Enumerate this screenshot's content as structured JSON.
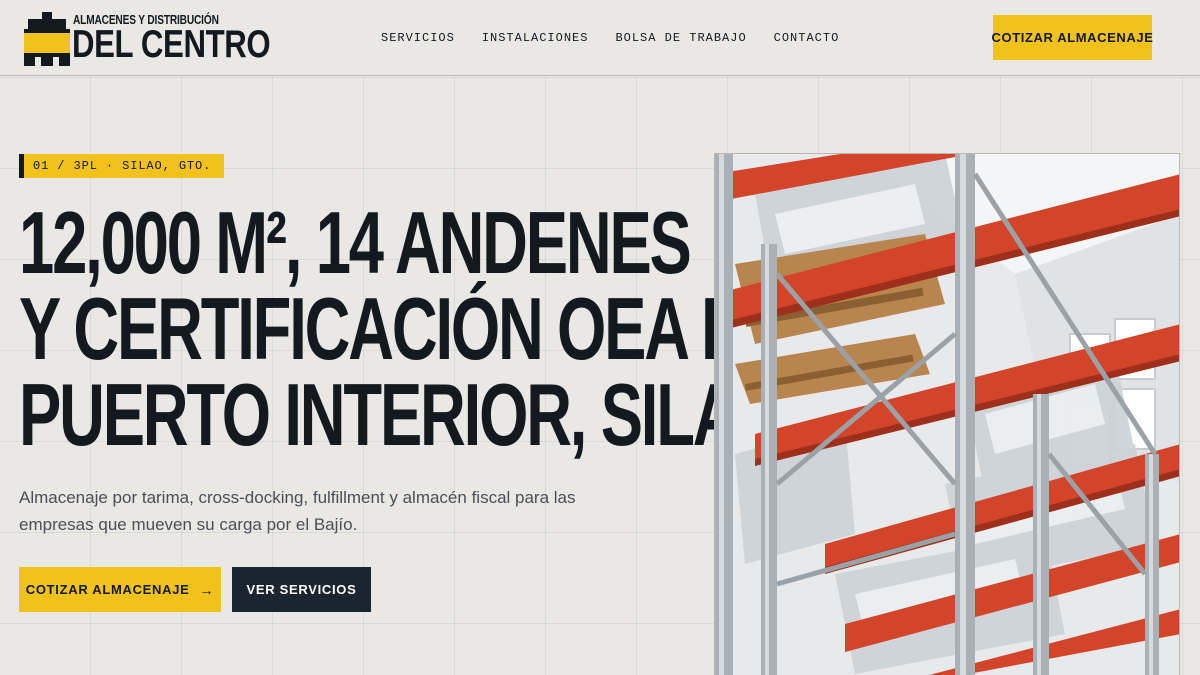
{
  "brand": {
    "name_top": "ALMACENES Y DISTRIBUCIÓN",
    "name_bottom": "DEL CENTRO",
    "logo_icon": "warehouse-pallet-logo",
    "colors": {
      "accent": "#f1c21b",
      "dark": "#14191f",
      "background": "#e9e8e5"
    }
  },
  "nav": {
    "items": [
      {
        "label": "SERVICIOS"
      },
      {
        "label": "INSTALACIONES"
      },
      {
        "label": "BOLSA DE TRABAJO"
      },
      {
        "label": "CONTACTO"
      }
    ],
    "cta_label": "COTIZAR ALMACENAJE"
  },
  "hero": {
    "eyebrow": "01 / 3PL · SILAO, GTO.",
    "headline_lines": [
      "12,000 m², 14 andenes",
      "y certificación OEA en",
      "Puerto Interior, Silao."
    ],
    "lead": "Almacenaje por tarima, cross-docking, fulfillment y almacén fiscal para las empresas que mueven su carga por el Bajío.",
    "primary_button": "COTIZAR ALMACENAJE",
    "primary_icon": "arrow-right-icon",
    "primary_arrow": "→",
    "secondary_button": "VER SERVICIOS",
    "image_subject": "warehouse-pallet-racking-photo"
  }
}
